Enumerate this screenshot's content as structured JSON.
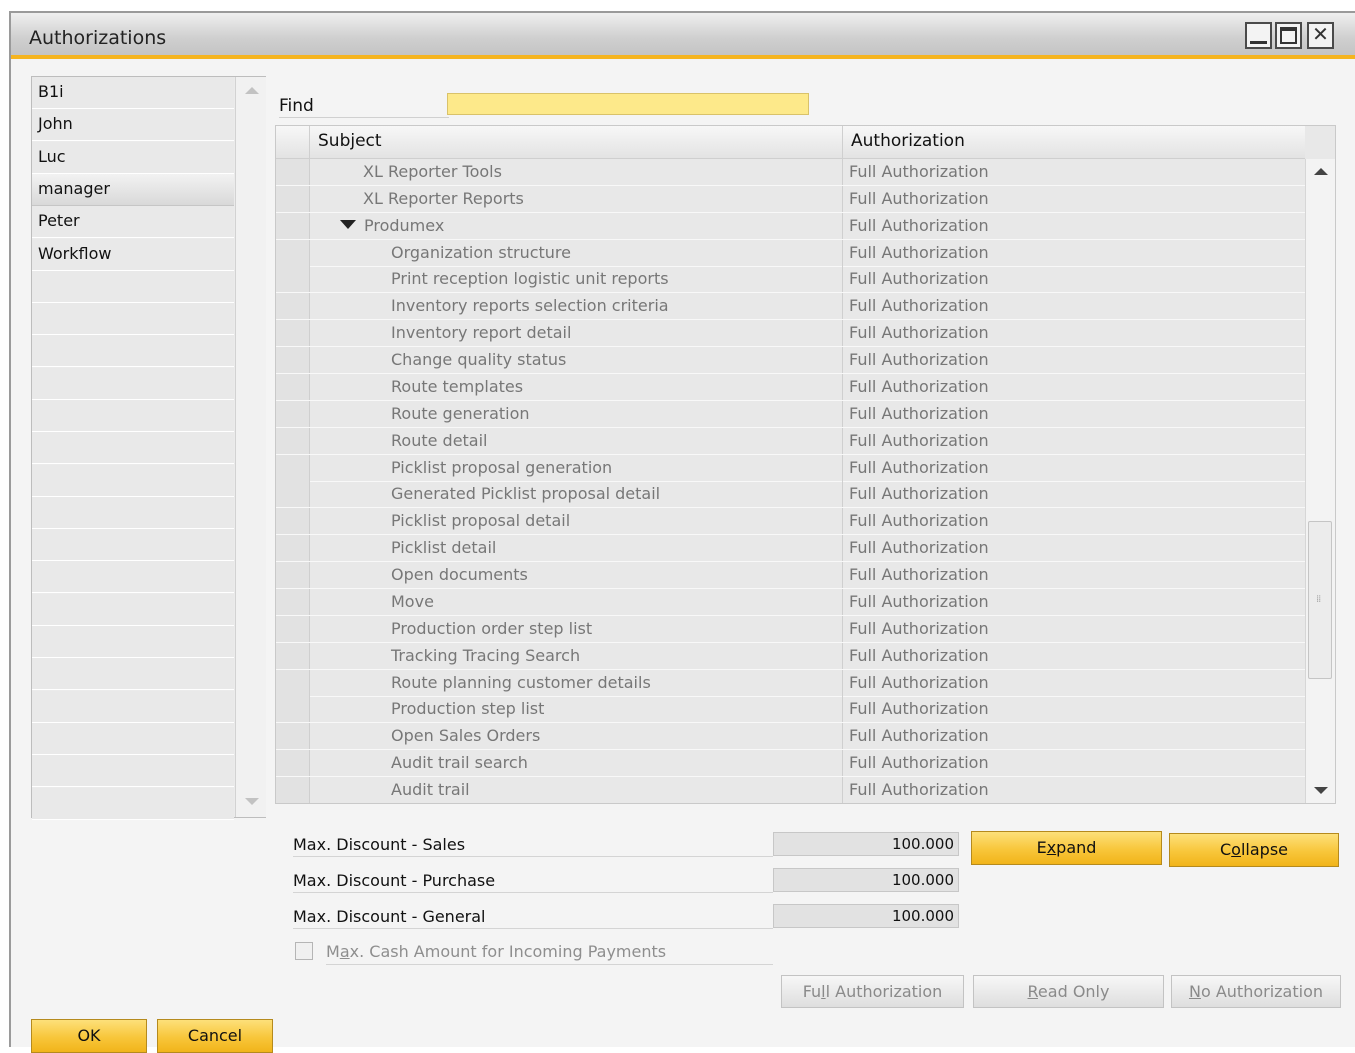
{
  "window": {
    "title": "Authorizations"
  },
  "users": [
    "B1i",
    "John",
    "Luc",
    "manager",
    "Peter",
    "Workflow"
  ],
  "selected_user": "manager",
  "find": {
    "label": "Find",
    "value": ""
  },
  "grid": {
    "columns": {
      "subject": "Subject",
      "authorization": "Authorization"
    },
    "rows": [
      {
        "subject": "XL Reporter Tools",
        "auth": "Full Authorization",
        "level": 1
      },
      {
        "subject": "XL Reporter Reports",
        "auth": "Full Authorization",
        "level": 1
      },
      {
        "subject": "Produmex",
        "auth": "Full Authorization",
        "level": 0,
        "expanded": true
      },
      {
        "subject": "Organization structure",
        "auth": "Full Authorization",
        "level": 2
      },
      {
        "subject": "Print reception logistic unit reports",
        "auth": "Full Authorization",
        "level": 2
      },
      {
        "subject": "Inventory reports selection criteria",
        "auth": "Full Authorization",
        "level": 2
      },
      {
        "subject": "Inventory report detail",
        "auth": "Full Authorization",
        "level": 2
      },
      {
        "subject": "Change quality status",
        "auth": "Full Authorization",
        "level": 2
      },
      {
        "subject": "Route templates",
        "auth": "Full Authorization",
        "level": 2
      },
      {
        "subject": "Route generation",
        "auth": "Full Authorization",
        "level": 2
      },
      {
        "subject": "Route detail",
        "auth": "Full Authorization",
        "level": 2
      },
      {
        "subject": "Picklist proposal generation",
        "auth": "Full Authorization",
        "level": 2
      },
      {
        "subject": "Generated Picklist proposal detail",
        "auth": "Full Authorization",
        "level": 2
      },
      {
        "subject": "Picklist proposal detail",
        "auth": "Full Authorization",
        "level": 2
      },
      {
        "subject": "Picklist detail",
        "auth": "Full Authorization",
        "level": 2
      },
      {
        "subject": "Open documents",
        "auth": "Full Authorization",
        "level": 2
      },
      {
        "subject": "Move",
        "auth": "Full Authorization",
        "level": 2
      },
      {
        "subject": "Production order step list",
        "auth": "Full Authorization",
        "level": 2
      },
      {
        "subject": "Tracking Tracing Search",
        "auth": "Full Authorization",
        "level": 2
      },
      {
        "subject": "Route planning customer details",
        "auth": "Full Authorization",
        "level": 2
      },
      {
        "subject": "Production step list",
        "auth": "Full Authorization",
        "level": 2
      },
      {
        "subject": "Open Sales Orders",
        "auth": "Full Authorization",
        "level": 2
      },
      {
        "subject": "Audit trail search",
        "auth": "Full Authorization",
        "level": 2
      },
      {
        "subject": "Audit trail",
        "auth": "Full Authorization",
        "level": 2
      }
    ]
  },
  "discounts": {
    "sales_label": "Max. Discount - Sales",
    "sales_value": "100.000",
    "purchase_label": "Max. Discount - Purchase",
    "purchase_value": "100.000",
    "general_label": "Max. Discount - General",
    "general_value": "100.000"
  },
  "cash": {
    "label_pre": "M",
    "label_ul": "a",
    "label_post": "x. Cash Amount for Incoming Payments",
    "checked": false
  },
  "buttons": {
    "expand_pre": "E",
    "expand_ul": "x",
    "expand_post": "pand",
    "collapse_pre": "C",
    "collapse_ul": "o",
    "collapse_post": "llapse",
    "full_pre": "Fu",
    "full_ul": "l",
    "full_post": "l Authorization",
    "read_pre": "",
    "read_ul": "R",
    "read_post": "ead Only",
    "no_pre": "",
    "no_ul": "N",
    "no_post": "o Authorization",
    "ok": "OK",
    "cancel": "Cancel"
  },
  "colors": {
    "accent": "#f5b41f",
    "find_bg": "#fde98a",
    "button_gold": "#f8c63a"
  }
}
